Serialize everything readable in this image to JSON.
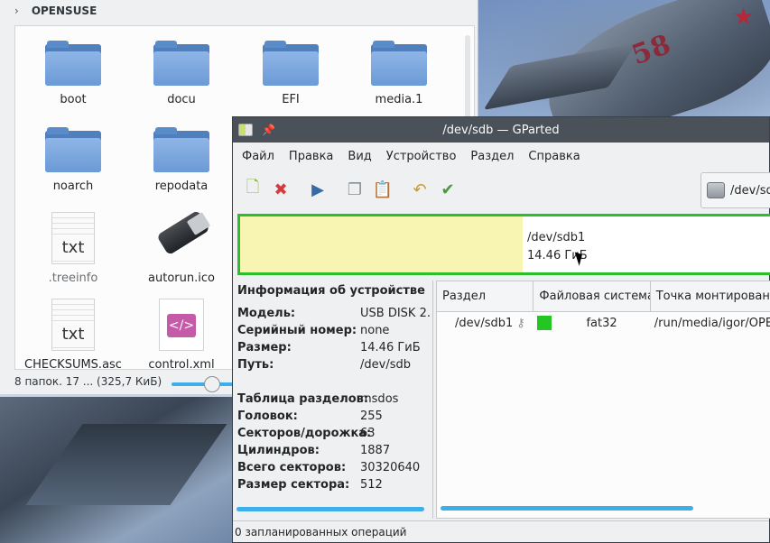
{
  "file_manager": {
    "path_label": "OPENSUSE",
    "items": [
      {
        "name": "boot",
        "type": "folder"
      },
      {
        "name": "docu",
        "type": "folder"
      },
      {
        "name": "EFI",
        "type": "folder"
      },
      {
        "name": "media.1",
        "type": "folder"
      },
      {
        "name": "noarch",
        "type": "folder"
      },
      {
        "name": "repodata",
        "type": "folder"
      },
      {
        "name": ".treeinfo",
        "type": "text",
        "icon_text": "txt"
      },
      {
        "name": "autorun.ico",
        "type": "usb"
      },
      {
        "name": "CHECKSUMS.asc",
        "type": "text",
        "icon_text": "txt"
      },
      {
        "name": "control.xml",
        "type": "xml",
        "icon_text": "</>"
      }
    ],
    "status": "8 папок. 17 ... (325,7 КиБ)"
  },
  "gparted": {
    "title": "/dev/sdb — GParted",
    "menu": [
      "Файл",
      "Правка",
      "Вид",
      "Устройство",
      "Раздел",
      "Справка"
    ],
    "device_selector": "/dev/sdb",
    "partition_map": {
      "name": "/dev/sdb1",
      "size": "14.46 ГиБ",
      "used_fraction": 0.53,
      "used_color": "#f8f4b2",
      "border_color": "#2bbf2b"
    },
    "device_info": {
      "title": "Информация об устройстве",
      "rows": [
        {
          "label": "Модель:",
          "value": "USB DISK 2."
        },
        {
          "label": "Серийный номер:",
          "value": "none"
        },
        {
          "label": "Размер:",
          "value": "14.46 ГиБ"
        },
        {
          "label": "Путь:",
          "value": "/dev/sdb"
        }
      ],
      "rows2": [
        {
          "label": "Таблица разделов:",
          "value": "msdos"
        },
        {
          "label": "Головок:",
          "value": "255"
        },
        {
          "label": "Секторов/дорожка:",
          "value": "63"
        },
        {
          "label": "Цилиндров:",
          "value": "1887"
        },
        {
          "label": "Всего секторов:",
          "value": "30320640"
        },
        {
          "label": "Размер сектора:",
          "value": "512"
        }
      ]
    },
    "table": {
      "columns": [
        "Раздел",
        "Файловая система",
        "Точка монтировани"
      ],
      "rows": [
        {
          "partition": "/dev/sdb1",
          "filesystem": "fat32",
          "fs_color": "#24c624",
          "mount": "/run/media/igor/OPE"
        }
      ]
    },
    "status": "0 запланированных операций"
  },
  "wallpaper": {
    "jet_number": "58"
  }
}
